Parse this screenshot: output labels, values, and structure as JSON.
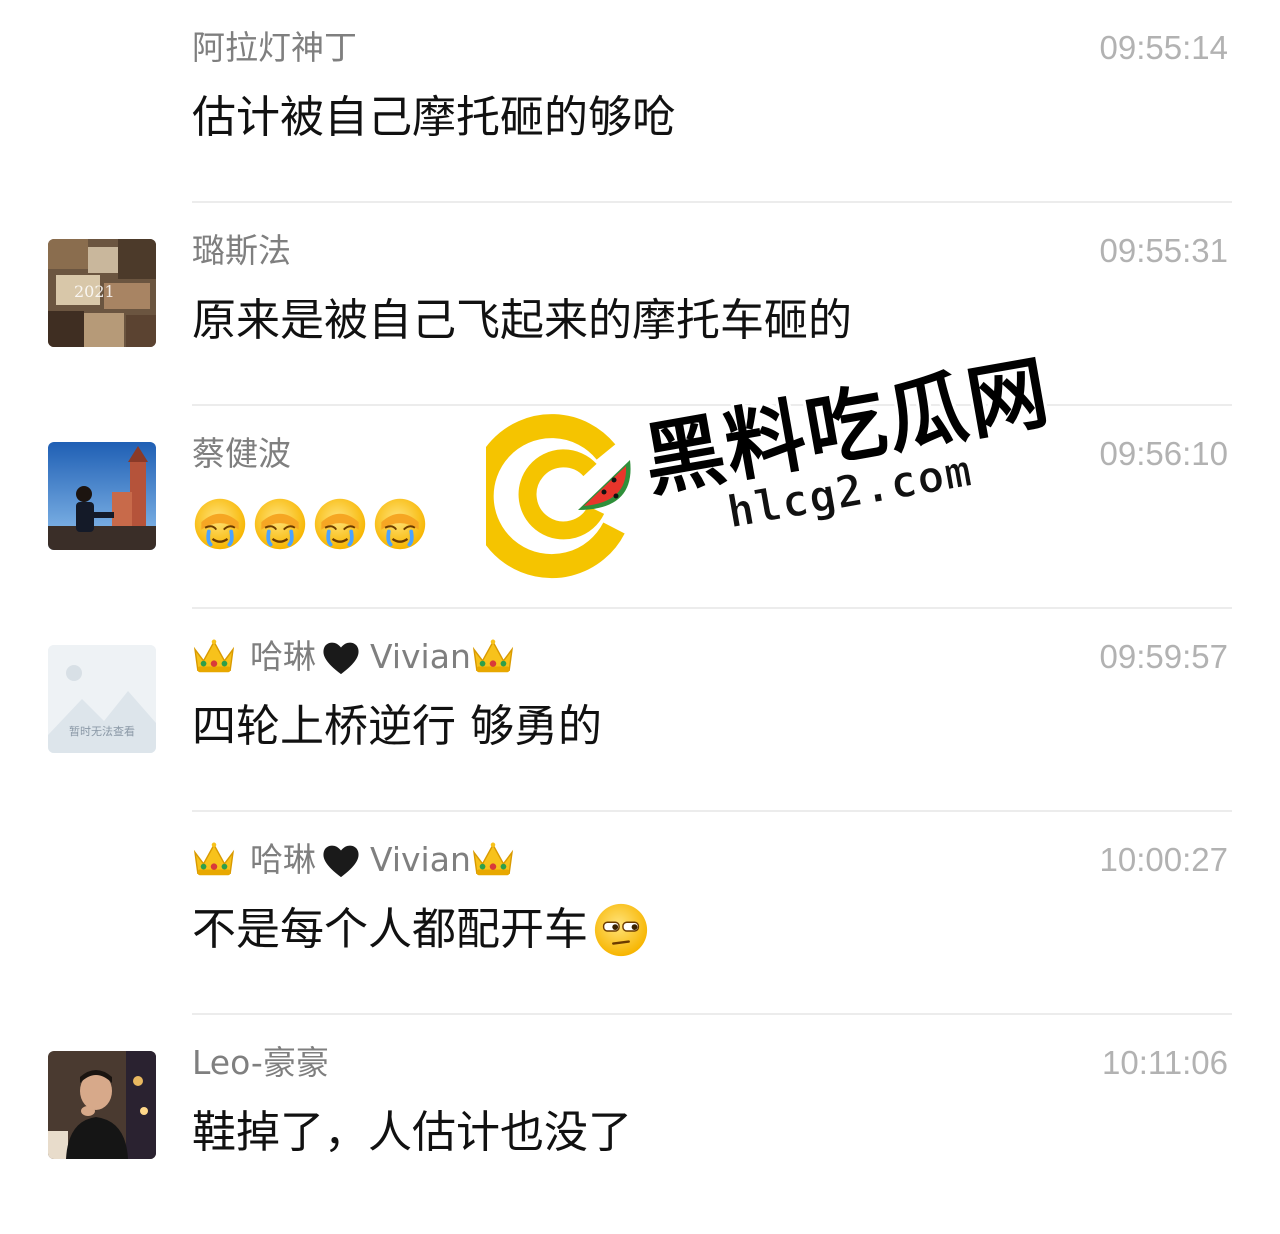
{
  "comments": [
    {
      "name": "阿拉灯神丁",
      "time": "09:55:14",
      "text": "估计被自己摩托砸的够呛",
      "avatar": "none"
    },
    {
      "name": "璐斯法",
      "time": "09:55:31",
      "text": "原来是被自己飞起来的摩托车砸的",
      "avatar": "photo-collage"
    },
    {
      "name": "蔡健波",
      "time": "09:56:10",
      "text": "",
      "emojis": [
        "facepalm-cry",
        "facepalm-cry",
        "facepalm-cry",
        "facepalm-cry"
      ],
      "avatar": "photo-castle"
    },
    {
      "name_main": "哈琳",
      "name_suffix": "Vivian",
      "time": "09:59:57",
      "text": "四轮上桥逆行 够勇的",
      "avatar": "placeholder",
      "avatar_placeholder_text": "暂时无法查看"
    },
    {
      "name_main": "哈琳",
      "name_suffix": "Vivian",
      "time": "10:00:27",
      "text": "不是每个人都配开车",
      "trailing_emoji": "side-eye",
      "avatar": "none"
    },
    {
      "name": "Leo-豪豪",
      "time": "10:11:06",
      "text": "鞋掉了，人估计也没了",
      "avatar": "photo-man"
    }
  ],
  "watermark": {
    "title": "黑料吃瓜网",
    "domain": "hlcg2.com"
  },
  "colors": {
    "name": "#7f7f7f",
    "time": "#b2b2b2",
    "text": "#111111",
    "divider": "#ececec",
    "watermark_logo": "#f5c400",
    "watermark_melon": "#e8352b"
  }
}
